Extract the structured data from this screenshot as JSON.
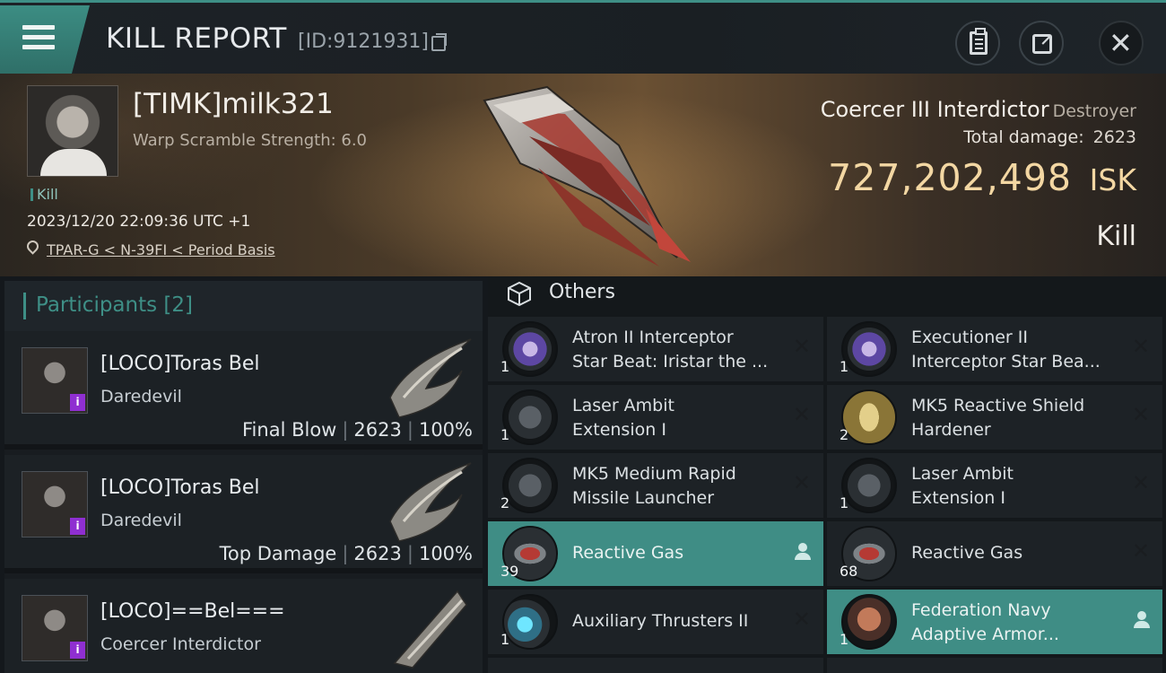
{
  "header": {
    "title": "KILL REPORT",
    "id_text": "[ID:9121931]"
  },
  "victim": {
    "name": "[TIMK]milk321",
    "stat": "Warp Scramble Strength: 6.0",
    "tag": "Kill",
    "datetime": "2023/12/20 22:09:36 UTC +1",
    "location": "TPAR-G < N-39FI < Period Basis",
    "ship_name": "Coercer III Interdictor",
    "ship_class": "Destroyer",
    "total_damage_label": "Total damage:",
    "total_damage": "2623",
    "isk_value": "727,202,498",
    "isk_unit": "ISK",
    "result": "Kill"
  },
  "participants": {
    "title": "Participants [2]",
    "rows": [
      {
        "name": "[LOCO]Toras Bel",
        "ship": "Daredevil",
        "role": "Final Blow",
        "damage": "2623",
        "percent": "100%",
        "badge": "i"
      },
      {
        "name": "[LOCO]Toras Bel",
        "ship": "Daredevil",
        "role": "Top Damage",
        "damage": "2623",
        "percent": "100%",
        "badge": "i"
      },
      {
        "name": "[LOCO]==Bel===",
        "ship": "Coercer Interdictor",
        "badge": "i"
      }
    ]
  },
  "others": {
    "title": "Others",
    "items": [
      {
        "name_1": "Atron II Interceptor",
        "name_2": "Star Beat: Iristar the ...",
        "qty": "1",
        "state": "destroyed"
      },
      {
        "name_1": "Executioner II",
        "name_2": "Interceptor Star Bea...",
        "qty": "1",
        "state": "destroyed"
      },
      {
        "name_1": "Laser Ambit",
        "name_2": "Extension I",
        "qty": "1",
        "state": "destroyed"
      },
      {
        "name_1": "MK5 Reactive Shield",
        "name_2": "Hardener",
        "qty": "2",
        "state": "destroyed"
      },
      {
        "name_1": "MK5 Medium Rapid",
        "name_2": "Missile Launcher",
        "qty": "2",
        "state": "destroyed"
      },
      {
        "name_1": "Laser Ambit",
        "name_2": "Extension I",
        "qty": "1",
        "state": "destroyed"
      },
      {
        "name_1": "Reactive Gas",
        "qty": "39",
        "state": "dropped"
      },
      {
        "name_1": "Reactive Gas",
        "qty": "68",
        "state": "destroyed"
      },
      {
        "name_1": "Auxiliary Thrusters II",
        "qty": "1",
        "state": "destroyed"
      },
      {
        "name_1": "Federation Navy",
        "name_2": "Adaptive Armor...",
        "qty": "1",
        "state": "dropped"
      }
    ]
  },
  "colors": {
    "accent": "#3e8f86",
    "isk": "#f3d7a3",
    "highlight_row": "#3f8d85",
    "badge": "#8f2fd1"
  }
}
